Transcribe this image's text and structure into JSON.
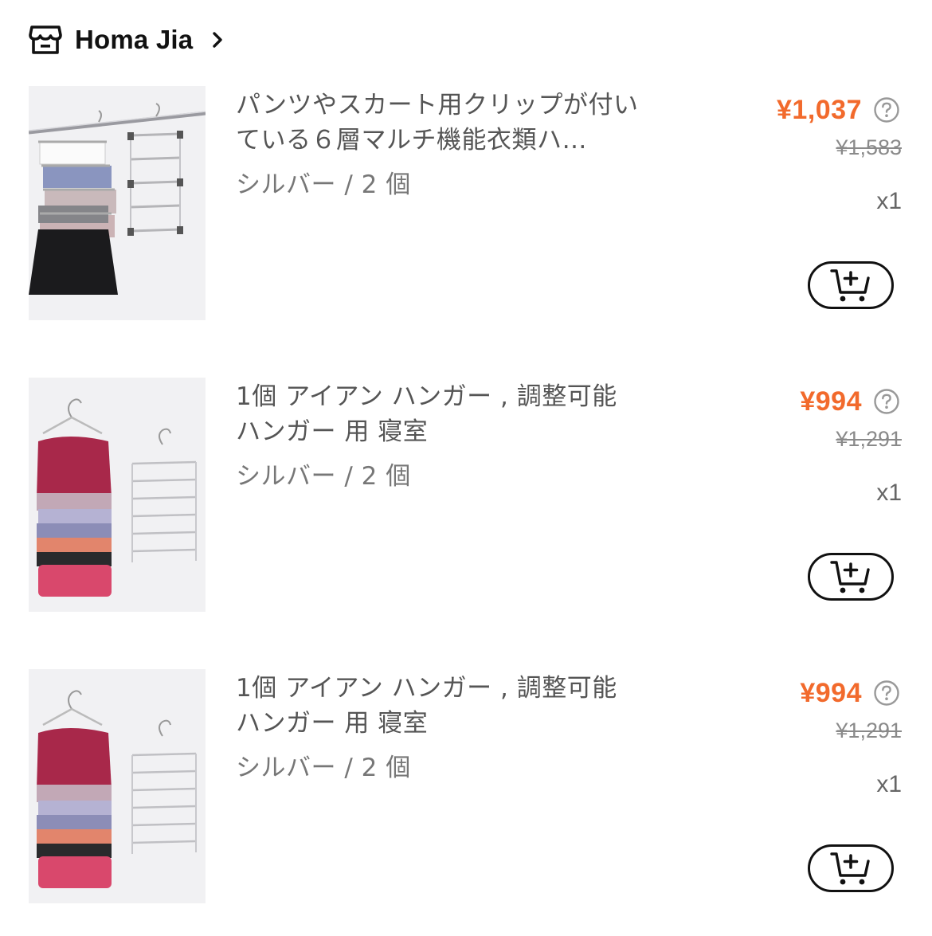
{
  "store": {
    "name": "Homa Jia",
    "icon": "store-icon",
    "chevron_icon": "chevron-right-icon"
  },
  "colors": {
    "price": "#f26a2c",
    "text": "#111111",
    "muted": "#777777"
  },
  "items": [
    {
      "title": "パンツやスカート用クリップが付いている６層マルチ機能衣類ハ…",
      "variant": "シルバー / 2 個",
      "price": "¥1,037",
      "original_price": "¥1,583",
      "quantity": "x1",
      "image": "skirt-hanger-image"
    },
    {
      "title": "1個 アイアン ハンガー , 調整可能 ハンガー 用 寝室",
      "variant": "シルバー / 2 個",
      "price": "¥994",
      "original_price": "¥1,291",
      "quantity": "x1",
      "image": "tank-top-hanger-image"
    },
    {
      "title": "1個 アイアン ハンガー , 調整可能 ハンガー 用 寝室",
      "variant": "シルバー / 2 個",
      "price": "¥994",
      "original_price": "¥1,291",
      "quantity": "x1",
      "image": "tank-top-hanger-image"
    }
  ]
}
